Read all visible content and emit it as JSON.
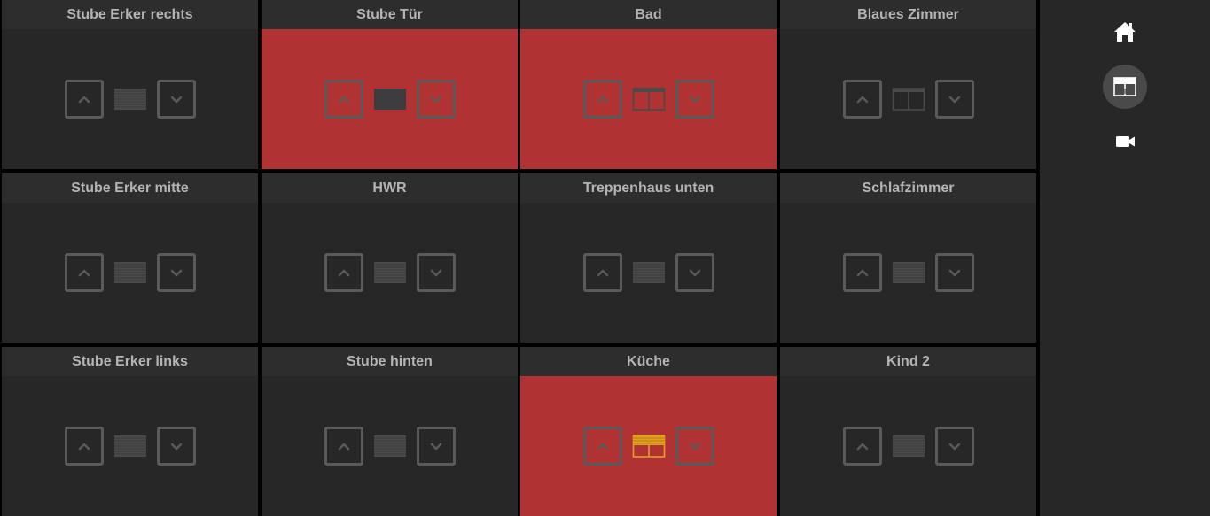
{
  "rooms": [
    {
      "name": "Stube Erker rechts",
      "state": "closed",
      "alarm": false
    },
    {
      "name": "Stube Tür",
      "state": "closed-dark",
      "alarm": true
    },
    {
      "name": "Bad",
      "state": "open",
      "alarm": true
    },
    {
      "name": "Blaues Zimmer",
      "state": "open",
      "alarm": false
    },
    {
      "name": "Stube Erker mitte",
      "state": "closed",
      "alarm": false
    },
    {
      "name": "HWR",
      "state": "closed",
      "alarm": false
    },
    {
      "name": "Treppenhaus unten",
      "state": "closed",
      "alarm": false
    },
    {
      "name": "Schlafzimmer",
      "state": "closed",
      "alarm": false
    },
    {
      "name": "Stube Erker links",
      "state": "closed",
      "alarm": false
    },
    {
      "name": "Stube hinten",
      "state": "closed",
      "alarm": false
    },
    {
      "name": "Küche",
      "state": "partial-yellow",
      "alarm": true
    },
    {
      "name": "Kind 2",
      "state": "closed",
      "alarm": false
    }
  ],
  "sidebar": {
    "items": [
      {
        "icon": "home-icon",
        "selected": false
      },
      {
        "icon": "shutter-icon",
        "selected": true
      },
      {
        "icon": "camera-icon",
        "selected": false
      }
    ]
  },
  "colors": {
    "background": "#000000",
    "tile": "#272727",
    "header": "#2d2d2d",
    "alarm": "#b03233",
    "border": "#5a5a5a",
    "text": "#b4b4b4",
    "highlight": "#e0a020"
  }
}
